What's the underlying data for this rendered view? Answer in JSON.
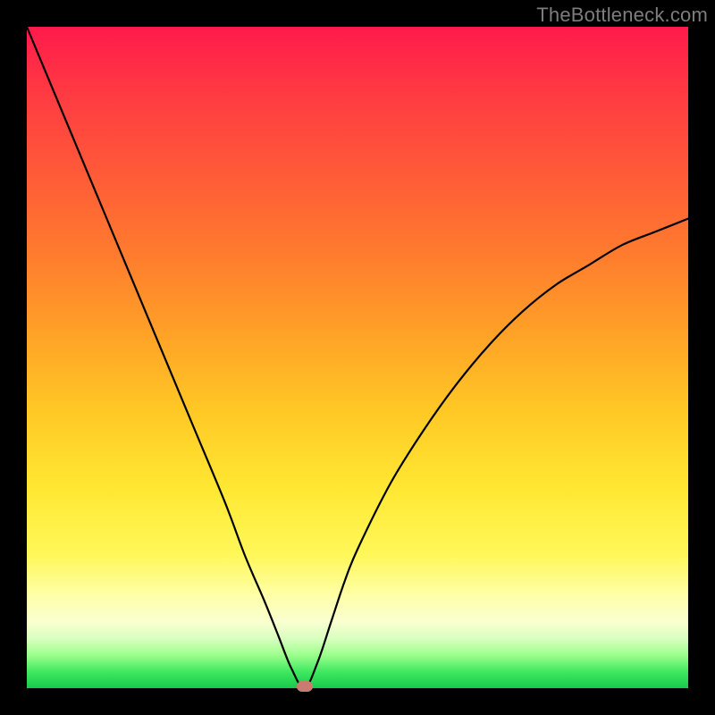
{
  "watermark": "TheBottleneck.com",
  "colors": {
    "frame": "#000000",
    "curve": "#000000",
    "marker": "#cb7a72",
    "gradient_top": "#ff1a4b",
    "gradient_bottom": "#17c94c"
  },
  "chart_data": {
    "type": "line",
    "title": "",
    "xlabel": "",
    "ylabel": "",
    "xlim": [
      0,
      100
    ],
    "ylim": [
      0,
      100
    ],
    "grid": false,
    "legend": false,
    "annotations": [
      "TheBottleneck.com"
    ],
    "marker": {
      "x": 42,
      "y": 0
    },
    "series": [
      {
        "name": "bottleneck-curve",
        "x": [
          0,
          5,
          10,
          15,
          20,
          25,
          30,
          33,
          36,
          38,
          40,
          42,
          44,
          46,
          48,
          50,
          55,
          60,
          65,
          70,
          75,
          80,
          85,
          90,
          95,
          100
        ],
        "values": [
          100,
          88,
          76,
          64,
          52,
          40,
          28,
          20,
          13,
          8,
          3,
          0,
          4,
          10,
          16,
          21,
          31,
          39,
          46,
          52,
          57,
          61,
          64,
          67,
          69,
          71
        ]
      }
    ]
  }
}
